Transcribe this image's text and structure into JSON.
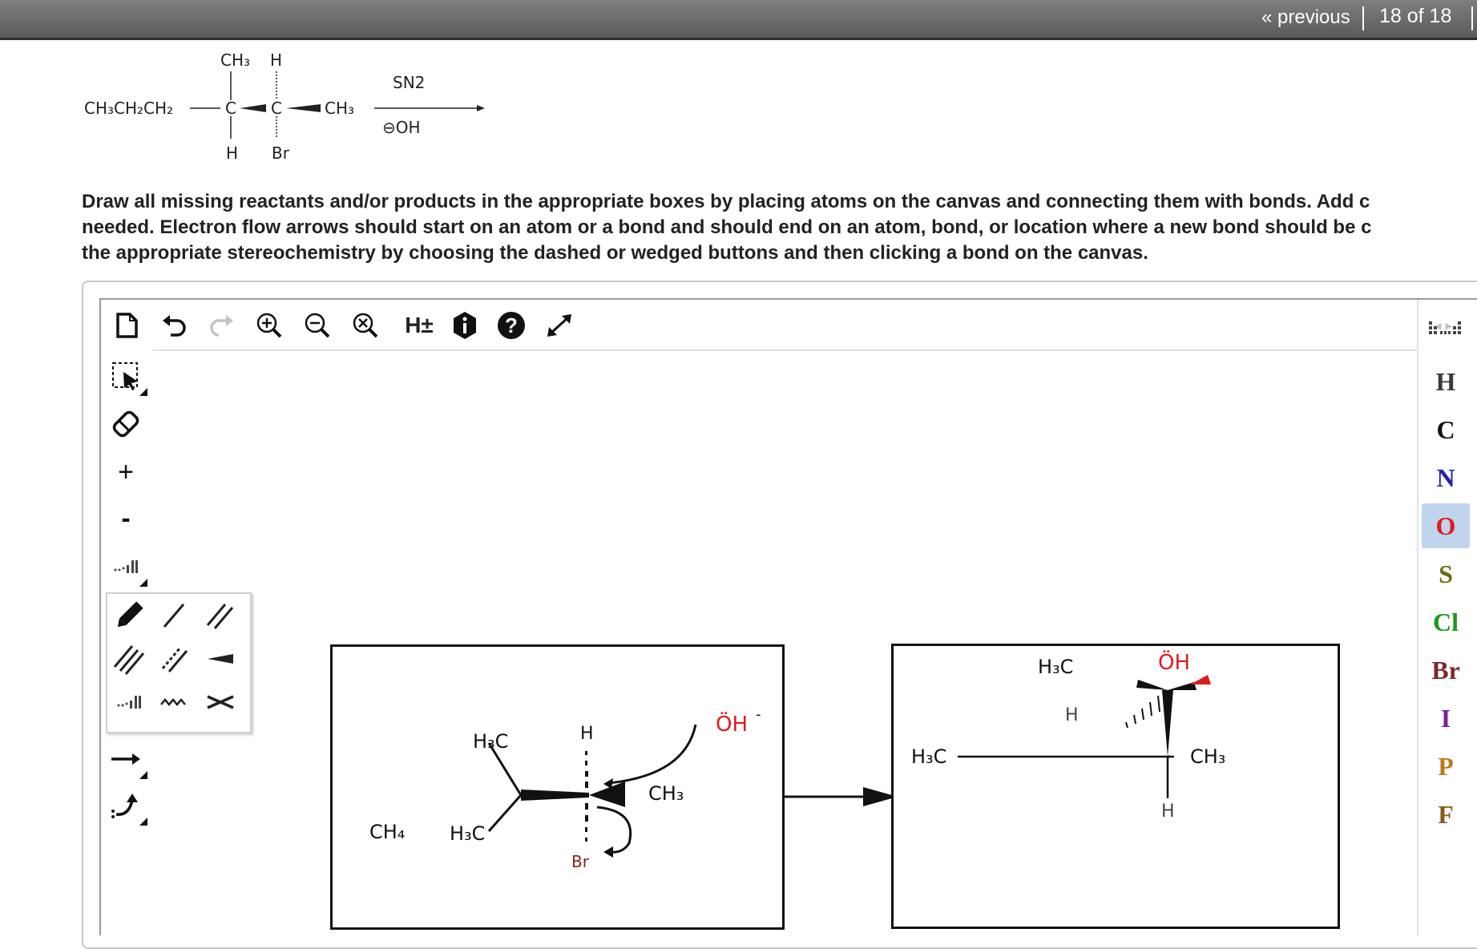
{
  "nav": {
    "previous": "« previous",
    "position": "18 of 18"
  },
  "scheme": {
    "reactant": {
      "left_chain": "CH₃CH₂CH₂",
      "top_ch3": "CH₃",
      "top_h": "H",
      "c1": "C",
      "c2": "C",
      "right_ch3": "CH₃",
      "bottom_h": "H",
      "bottom_br": "Br"
    },
    "condition_top": "SN2",
    "condition_bottom": "⊖OH"
  },
  "instructions": [
    "Draw all missing reactants and/or products in the appropriate boxes by placing atoms on the canvas and connecting them with bonds. Add c",
    "needed. Electron flow arrows should start on an atom or a bond and should end on an atom, bond, or location where a new bond should be c",
    "the appropriate stereochemistry by choosing the dashed or wedged buttons and then clicking a bond on the canvas."
  ],
  "toolbar": {
    "h_toggle": "H±",
    "plus": "+",
    "minus": "-"
  },
  "left_box": {
    "ch4": "CH₄",
    "h3c_top": "H₃C",
    "h3c_bottom": "H₃C",
    "h": "H",
    "ch3": "CH₃",
    "oh": "ÖH",
    "oh_charge": "-",
    "br": "Br"
  },
  "right_box": {
    "h3c_top": "H₃C",
    "oh": "ÖH",
    "h_hash": "H",
    "h3c_left": "H₃C",
    "ch3": "CH₃",
    "h_bottom": "H"
  },
  "elements": [
    {
      "symbol": "H",
      "color": "#3a3a3a"
    },
    {
      "symbol": "C",
      "color": "#111111"
    },
    {
      "symbol": "N",
      "color": "#2323a8"
    },
    {
      "symbol": "O",
      "color": "#e01b1b"
    },
    {
      "symbol": "S",
      "color": "#6b6b12"
    },
    {
      "symbol": "Cl",
      "color": "#1a9a1a"
    },
    {
      "symbol": "Br",
      "color": "#7a2a2a"
    },
    {
      "symbol": "I",
      "color": "#7a1fa0"
    },
    {
      "symbol": "P",
      "color": "#c07a14"
    },
    {
      "symbol": "F",
      "color": "#8a5a14"
    }
  ],
  "selected_element": "O"
}
